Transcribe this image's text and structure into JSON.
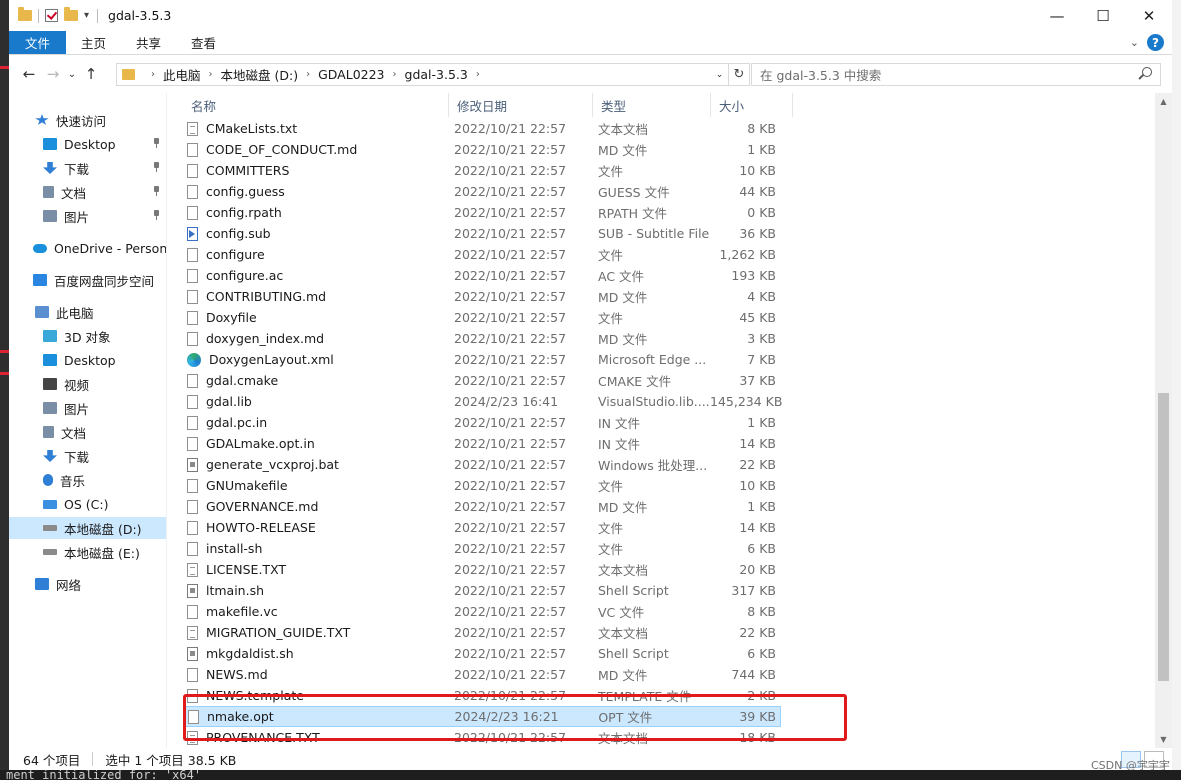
{
  "window": {
    "title": "gdal-3.5.3"
  },
  "titlebar": {
    "minimize_glyph": "—",
    "maximize_glyph": "☐",
    "close_glyph": "✕"
  },
  "ribbon": {
    "tabs": [
      "文件",
      "主页",
      "共享",
      "查看"
    ],
    "collapse_glyph": "⌄",
    "help_glyph": "?"
  },
  "nav": {
    "back_glyph": "←",
    "forward_glyph": "→",
    "recent_glyph": "⌄",
    "up_glyph": "↑"
  },
  "address": {
    "crumbs": [
      "此电脑",
      "本地磁盘 (D:)",
      "GDAL0223",
      "gdal-3.5.3"
    ],
    "separator": "›",
    "dropdown_glyph": "⌄",
    "refresh_glyph": "↻"
  },
  "search": {
    "placeholder": "在 gdal-3.5.3 中搜索"
  },
  "sidebar": {
    "items": [
      {
        "label": "快速访问",
        "icon": "star-icon",
        "color": "#2f7fd6"
      },
      {
        "label": "Desktop",
        "icon": "desktop-icon",
        "color": "#1a8fdc",
        "pinned": true
      },
      {
        "label": "下载",
        "icon": "download-icon",
        "color": "#2f7fd6",
        "pinned": true
      },
      {
        "label": "文档",
        "icon": "documents-icon",
        "color": "#7a8fa6",
        "pinned": true
      },
      {
        "label": "图片",
        "icon": "pictures-icon",
        "color": "#7a8fa6",
        "pinned": true
      },
      {
        "label": "OneDrive - Personal",
        "icon": "onedrive-icon",
        "color": "#1a8fdc"
      },
      {
        "label": "百度网盘同步空间",
        "icon": "baidu-icon",
        "color": "#2a86e0"
      },
      {
        "label": "此电脑",
        "icon": "computer-icon",
        "color": "#5a8fd0"
      },
      {
        "label": "3D 对象",
        "icon": "3d-objects-icon",
        "color": "#38a8d8"
      },
      {
        "label": "Desktop",
        "icon": "desktop-icon",
        "color": "#1a8fdc"
      },
      {
        "label": "视频",
        "icon": "video-icon",
        "color": "#444444"
      },
      {
        "label": "图片",
        "icon": "pictures-icon",
        "color": "#7a8fa6"
      },
      {
        "label": "文档",
        "icon": "documents-icon",
        "color": "#7a8fa6"
      },
      {
        "label": "下载",
        "icon": "download-icon",
        "color": "#2f7fd6"
      },
      {
        "label": "音乐",
        "icon": "music-icon",
        "color": "#2f7fd6"
      },
      {
        "label": "OS (C:)",
        "icon": "windows-drive-icon",
        "color": "#3b8fe0"
      },
      {
        "label": "本地磁盘 (D:)",
        "icon": "drive-icon",
        "color": "#8a8a8a",
        "selected": true
      },
      {
        "label": "本地磁盘 (E:)",
        "icon": "drive-icon",
        "color": "#8a8a8a"
      },
      {
        "label": "网络",
        "icon": "network-icon",
        "color": "#2f7fd6"
      }
    ]
  },
  "columns": {
    "name": "名称",
    "date": "修改日期",
    "type": "类型",
    "size": "大小",
    "sort_glyph": "^"
  },
  "files": [
    {
      "name": "CMakeLists.txt",
      "date": "2022/10/21 22:57",
      "type": "文本文档",
      "size": "8 KB",
      "icon": "text-file-icon"
    },
    {
      "name": "CODE_OF_CONDUCT.md",
      "date": "2022/10/21 22:57",
      "type": "MD 文件",
      "size": "1 KB",
      "icon": "file-icon"
    },
    {
      "name": "COMMITTERS",
      "date": "2022/10/21 22:57",
      "type": "文件",
      "size": "10 KB",
      "icon": "file-icon"
    },
    {
      "name": "config.guess",
      "date": "2022/10/21 22:57",
      "type": "GUESS 文件",
      "size": "44 KB",
      "icon": "file-icon"
    },
    {
      "name": "config.rpath",
      "date": "2022/10/21 22:57",
      "type": "RPATH 文件",
      "size": "0 KB",
      "icon": "file-icon"
    },
    {
      "name": "config.sub",
      "date": "2022/10/21 22:57",
      "type": "SUB - Subtitle File",
      "size": "36 KB",
      "icon": "subtitle-file-icon"
    },
    {
      "name": "configure",
      "date": "2022/10/21 22:57",
      "type": "文件",
      "size": "1,262 KB",
      "icon": "file-icon"
    },
    {
      "name": "configure.ac",
      "date": "2022/10/21 22:57",
      "type": "AC 文件",
      "size": "193 KB",
      "icon": "file-icon"
    },
    {
      "name": "CONTRIBUTING.md",
      "date": "2022/10/21 22:57",
      "type": "MD 文件",
      "size": "4 KB",
      "icon": "file-icon"
    },
    {
      "name": "Doxyfile",
      "date": "2022/10/21 22:57",
      "type": "文件",
      "size": "45 KB",
      "icon": "file-icon"
    },
    {
      "name": "doxygen_index.md",
      "date": "2022/10/21 22:57",
      "type": "MD 文件",
      "size": "3 KB",
      "icon": "file-icon"
    },
    {
      "name": "DoxygenLayout.xml",
      "date": "2022/10/21 22:57",
      "type": "Microsoft Edge ...",
      "size": "7 KB",
      "icon": "edge-file-icon"
    },
    {
      "name": "gdal.cmake",
      "date": "2022/10/21 22:57",
      "type": "CMAKE 文件",
      "size": "37 KB",
      "icon": "file-icon"
    },
    {
      "name": "gdal.lib",
      "date": "2024/2/23 16:41",
      "type": "VisualStudio.lib....",
      "size": "145,234 KB",
      "icon": "file-icon"
    },
    {
      "name": "gdal.pc.in",
      "date": "2022/10/21 22:57",
      "type": "IN 文件",
      "size": "1 KB",
      "icon": "file-icon"
    },
    {
      "name": "GDALmake.opt.in",
      "date": "2022/10/21 22:57",
      "type": "IN 文件",
      "size": "14 KB",
      "icon": "file-icon"
    },
    {
      "name": "generate_vcxproj.bat",
      "date": "2022/10/21 22:57",
      "type": "Windows 批处理...",
      "size": "22 KB",
      "icon": "batch-file-icon"
    },
    {
      "name": "GNUmakefile",
      "date": "2022/10/21 22:57",
      "type": "文件",
      "size": "10 KB",
      "icon": "file-icon"
    },
    {
      "name": "GOVERNANCE.md",
      "date": "2022/10/21 22:57",
      "type": "MD 文件",
      "size": "1 KB",
      "icon": "file-icon"
    },
    {
      "name": "HOWTO-RELEASE",
      "date": "2022/10/21 22:57",
      "type": "文件",
      "size": "14 KB",
      "icon": "file-icon"
    },
    {
      "name": "install-sh",
      "date": "2022/10/21 22:57",
      "type": "文件",
      "size": "6 KB",
      "icon": "file-icon"
    },
    {
      "name": "LICENSE.TXT",
      "date": "2022/10/21 22:57",
      "type": "文本文档",
      "size": "20 KB",
      "icon": "text-file-icon"
    },
    {
      "name": "ltmain.sh",
      "date": "2022/10/21 22:57",
      "type": "Shell Script",
      "size": "317 KB",
      "icon": "script-file-icon"
    },
    {
      "name": "makefile.vc",
      "date": "2022/10/21 22:57",
      "type": "VC 文件",
      "size": "8 KB",
      "icon": "file-icon"
    },
    {
      "name": "MIGRATION_GUIDE.TXT",
      "date": "2022/10/21 22:57",
      "type": "文本文档",
      "size": "22 KB",
      "icon": "text-file-icon"
    },
    {
      "name": "mkgdaldist.sh",
      "date": "2022/10/21 22:57",
      "type": "Shell Script",
      "size": "6 KB",
      "icon": "script-file-icon"
    },
    {
      "name": "NEWS.md",
      "date": "2022/10/21 22:57",
      "type": "MD 文件",
      "size": "744 KB",
      "icon": "file-icon"
    },
    {
      "name": "NEWS.template",
      "date": "2022/10/21 22:57",
      "type": "TEMPLATE 文件",
      "size": "2 KB",
      "icon": "file-icon"
    },
    {
      "name": "nmake.opt",
      "date": "2024/2/23 16:21",
      "type": "OPT 文件",
      "size": "39 KB",
      "icon": "file-icon",
      "selected": true
    },
    {
      "name": "PROVENANCE.TXT",
      "date": "2022/10/21 22:57",
      "type": "文本文档",
      "size": "18 KB",
      "icon": "text-file-icon"
    }
  ],
  "status": {
    "count": "64 个项目",
    "selection": "选中 1 个项目  38.5 KB"
  },
  "watermark": "CSDN @宇宇宇",
  "background_terminal": "ment initialized for: 'x64'",
  "colors": {
    "accent": "#1979ca",
    "selection": "#cce8ff",
    "highlight_box": "#e0191b"
  }
}
